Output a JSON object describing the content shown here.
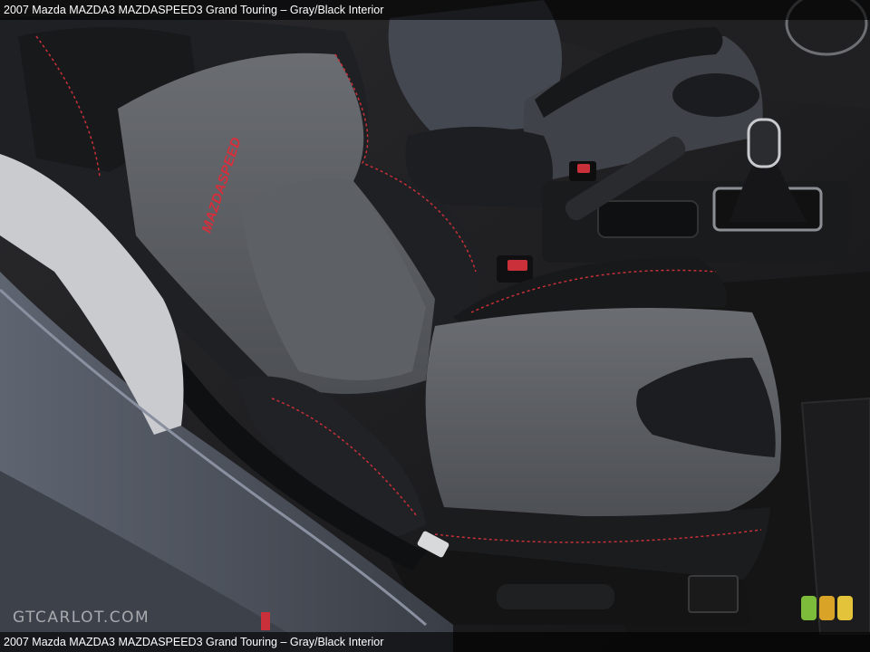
{
  "caption": {
    "top": "2007 Mazda MAZDA3 MAZDASPEED3 Grand Touring – Gray/Black Interior",
    "bottom": "2007 Mazda MAZDA3 MAZDASPEED3 Grand Touring – Gray/Black Interior"
  },
  "watermark": {
    "text": "GTCARLOT.COM"
  },
  "seat_logo": {
    "text": "MAZDASPEED"
  },
  "colors": {
    "stitch": "#c9303a",
    "cloth": "#5a5d62",
    "leather": "#1e1f22",
    "badge_green": "#7dbb3a",
    "badge_amber": "#d8a326",
    "badge_yellow": "#e2c33a"
  }
}
